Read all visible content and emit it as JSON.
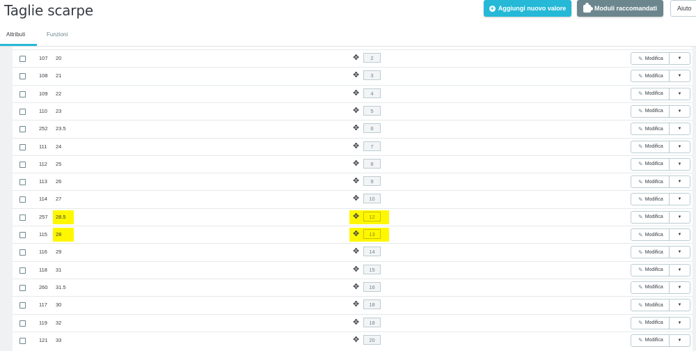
{
  "header": {
    "title": "Taglie scarpe",
    "add_button": "Aggiungi nuovo valore",
    "modules_button": "Moduli raccomandati",
    "help_button": "Aiuto"
  },
  "tabs": [
    {
      "label": "Attributi",
      "active": true
    },
    {
      "label": "Funzioni",
      "active": false
    }
  ],
  "table": {
    "edit_label": "Modifica",
    "rows": [
      {
        "id": "107",
        "value": "20",
        "position": "2",
        "highlight": false
      },
      {
        "id": "108",
        "value": "21",
        "position": "3",
        "highlight": false
      },
      {
        "id": "109",
        "value": "22",
        "position": "4",
        "highlight": false
      },
      {
        "id": "110",
        "value": "23",
        "position": "5",
        "highlight": false
      },
      {
        "id": "252",
        "value": "23.5",
        "position": "6",
        "highlight": false
      },
      {
        "id": "111",
        "value": "24",
        "position": "7",
        "highlight": false
      },
      {
        "id": "112",
        "value": "25",
        "position": "8",
        "highlight": false
      },
      {
        "id": "113",
        "value": "26",
        "position": "9",
        "highlight": false
      },
      {
        "id": "114",
        "value": "27",
        "position": "10",
        "highlight": false
      },
      {
        "id": "257",
        "value": "28.5",
        "position": "12",
        "highlight": true
      },
      {
        "id": "115",
        "value": "28",
        "position": "13",
        "highlight": true
      },
      {
        "id": "116",
        "value": "29",
        "position": "14",
        "highlight": false
      },
      {
        "id": "118",
        "value": "31",
        "position": "15",
        "highlight": false
      },
      {
        "id": "260",
        "value": "31.5",
        "position": "16",
        "highlight": false
      },
      {
        "id": "117",
        "value": "30",
        "position": "18",
        "highlight": false
      },
      {
        "id": "119",
        "value": "32",
        "position": "18",
        "highlight": false
      },
      {
        "id": "121",
        "value": "33",
        "position": "20",
        "highlight": false
      }
    ]
  },
  "colors": {
    "primary": "#25b9d7",
    "secondary": "#6c868e",
    "highlight": "#fff700"
  }
}
